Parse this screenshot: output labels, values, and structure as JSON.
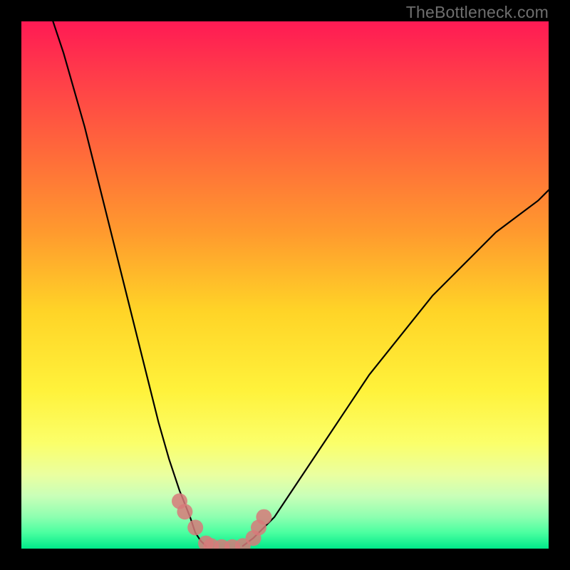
{
  "watermark": "TheBottleneck.com",
  "chart_data": {
    "type": "line",
    "title": "",
    "xlabel": "",
    "ylabel": "",
    "xlim": [
      0,
      100
    ],
    "ylim": [
      0,
      100
    ],
    "series": [
      {
        "name": "curve-left",
        "color": "#000000",
        "x": [
          6,
          8,
          10,
          12,
          14,
          16,
          18,
          20,
          22,
          24,
          26,
          28,
          30,
          32,
          33,
          34,
          35
        ],
        "y": [
          100,
          94,
          87,
          80,
          72,
          64,
          56,
          48,
          40,
          32,
          24,
          17,
          11,
          6,
          3,
          1.5,
          0.5
        ]
      },
      {
        "name": "curve-right",
        "color": "#000000",
        "x": [
          42,
          44,
          46,
          48,
          50,
          54,
          58,
          62,
          66,
          70,
          74,
          78,
          82,
          86,
          90,
          94,
          98,
          100
        ],
        "y": [
          0.5,
          2,
          4,
          6,
          9,
          15,
          21,
          27,
          33,
          38,
          43,
          48,
          52,
          56,
          60,
          63,
          66,
          68
        ]
      },
      {
        "name": "markers",
        "type": "scatter",
        "color": "#d77a7a",
        "x": [
          30,
          31,
          33,
          35,
          36,
          38,
          40,
          42,
          44,
          45,
          46
        ],
        "y": [
          9,
          7,
          4,
          1,
          0.5,
          0.3,
          0.3,
          0.5,
          2,
          4,
          6
        ]
      }
    ],
    "gradient_stops": [
      {
        "offset": 0.0,
        "color": "#ff1a54"
      },
      {
        "offset": 0.1,
        "color": "#ff3b4a"
      },
      {
        "offset": 0.25,
        "color": "#ff6a3a"
      },
      {
        "offset": 0.4,
        "color": "#ff9a2e"
      },
      {
        "offset": 0.55,
        "color": "#ffd427"
      },
      {
        "offset": 0.7,
        "color": "#fff23b"
      },
      {
        "offset": 0.8,
        "color": "#fbff6a"
      },
      {
        "offset": 0.86,
        "color": "#eaffa0"
      },
      {
        "offset": 0.9,
        "color": "#c9ffb8"
      },
      {
        "offset": 0.94,
        "color": "#8dffb0"
      },
      {
        "offset": 0.97,
        "color": "#4affa0"
      },
      {
        "offset": 1.0,
        "color": "#00e98a"
      }
    ]
  }
}
